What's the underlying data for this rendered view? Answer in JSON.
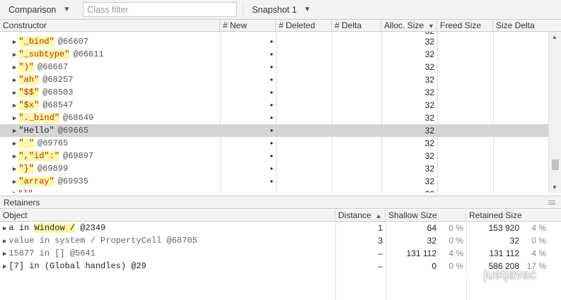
{
  "toolbar": {
    "view_select": "Comparison",
    "filter_placeholder": "Class filter",
    "snapshot_select": "Snapshot 1"
  },
  "grid": {
    "columns": [
      "Constructor",
      "# New",
      "# Deleted",
      "# Delta",
      "Alloc. Size",
      "Freed Size",
      "Size Delta"
    ],
    "sorted_column": "Alloc. Size",
    "rows": [
      {
        "name": "\"_bind\"",
        "id": "@66607",
        "new_dot": "•",
        "alloc": "32",
        "highlight": true
      },
      {
        "name": "\"_subtype\"",
        "id": "@66611",
        "new_dot": "•",
        "alloc": "32",
        "highlight": true
      },
      {
        "name": "\")\"",
        "id": "@66667",
        "new_dot": "•",
        "alloc": "32",
        "highlight": true
      },
      {
        "name": "\"ah\"",
        "id": "@68257",
        "new_dot": "•",
        "alloc": "32",
        "highlight": true
      },
      {
        "name": "\"$$\"",
        "id": "@68503",
        "new_dot": "•",
        "alloc": "32",
        "highlight": true
      },
      {
        "name": "\"$x\"",
        "id": "@68547",
        "new_dot": "•",
        "alloc": "32",
        "highlight": true
      },
      {
        "name": "\"._bind\"",
        "id": "@68649",
        "new_dot": "•",
        "alloc": "32",
        "highlight": true
      },
      {
        "name": "\"Hello\"",
        "id": "@69665",
        "new_dot": "•",
        "alloc": "32",
        "highlight": false,
        "selected": true
      },
      {
        "name": "\" \"",
        "id": "@69765",
        "new_dot": "•",
        "alloc": "32",
        "highlight": true
      },
      {
        "name": "\",\"id\":\"",
        "id": "@69897",
        "new_dot": "•",
        "alloc": "32",
        "highlight": true
      },
      {
        "name": "\"}\"",
        "id": "@69899",
        "new_dot": "•",
        "alloc": "32",
        "highlight": true
      },
      {
        "name": "\"array\"",
        "id": "@69935",
        "new_dot": "•",
        "alloc": "32",
        "highlight": true
      }
    ],
    "partial_top_alloc": "32",
    "partial_bottom_alloc": "32"
  },
  "retainers": {
    "title": "Retainers",
    "columns": [
      "Object",
      "Distance",
      "Shallow Size",
      "Retained Size"
    ],
    "sorted_column": "Distance",
    "rows": [
      {
        "prefix": "a in ",
        "highlight": "Window /",
        "suffix": " @2349",
        "distance": "1",
        "shallow": "64",
        "shallow_pct": "0 %",
        "retained": "153 920",
        "retained_pct": "4 %"
      },
      {
        "prefix": "value in system / PropertyCell @68705",
        "highlight": "",
        "suffix": "",
        "distance": "3",
        "shallow": "32",
        "shallow_pct": "0 %",
        "retained": "32",
        "retained_pct": "0 %",
        "grey": true
      },
      {
        "prefix": "15677 in [] @5641",
        "highlight": "",
        "suffix": "",
        "distance": "–",
        "shallow": "131 112",
        "shallow_pct": "4 %",
        "retained": "131 112",
        "retained_pct": "4 %",
        "grey": true
      },
      {
        "prefix": "[7] in (Global handles) @29",
        "highlight": "",
        "suffix": "",
        "distance": "–",
        "shallow": "0",
        "shallow_pct": "0 %",
        "retained": "586 208",
        "retained_pct": "17 %",
        "grey": false
      }
    ]
  },
  "watermark": "justjavac"
}
